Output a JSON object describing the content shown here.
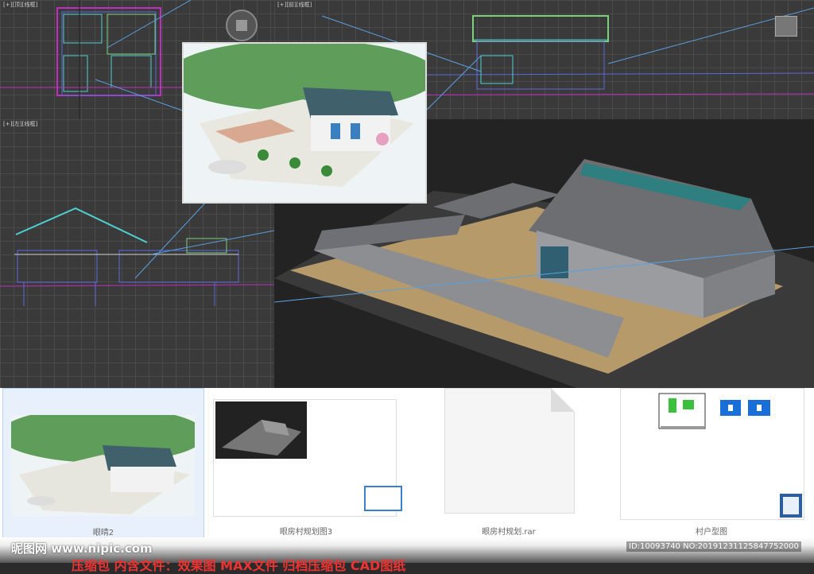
{
  "viewports": {
    "top_label": "[+][顶][线框]",
    "front_label": "[+][前][线框]",
    "left_label": "[+][左][线框]"
  },
  "files": [
    {
      "name": "眼晴2"
    },
    {
      "name": "眼房村规划图3"
    },
    {
      "name": "眼房村规划.rar"
    },
    {
      "name": "村户型图"
    }
  ],
  "watermark": {
    "logo": "昵图网 www.nipic.com",
    "id": "ID:10093740 NO:20191231125847752000",
    "banner": "压缩包 内含文件：效果图 MAX文件 归档压缩包 CAD图纸"
  },
  "colors": {
    "grid": "#4a4a4a",
    "wire_cyan": "#4fd0d0",
    "wire_blue": "#5a6ad8",
    "wire_magenta": "#c02dc0",
    "banner_red": "#ee3333"
  }
}
